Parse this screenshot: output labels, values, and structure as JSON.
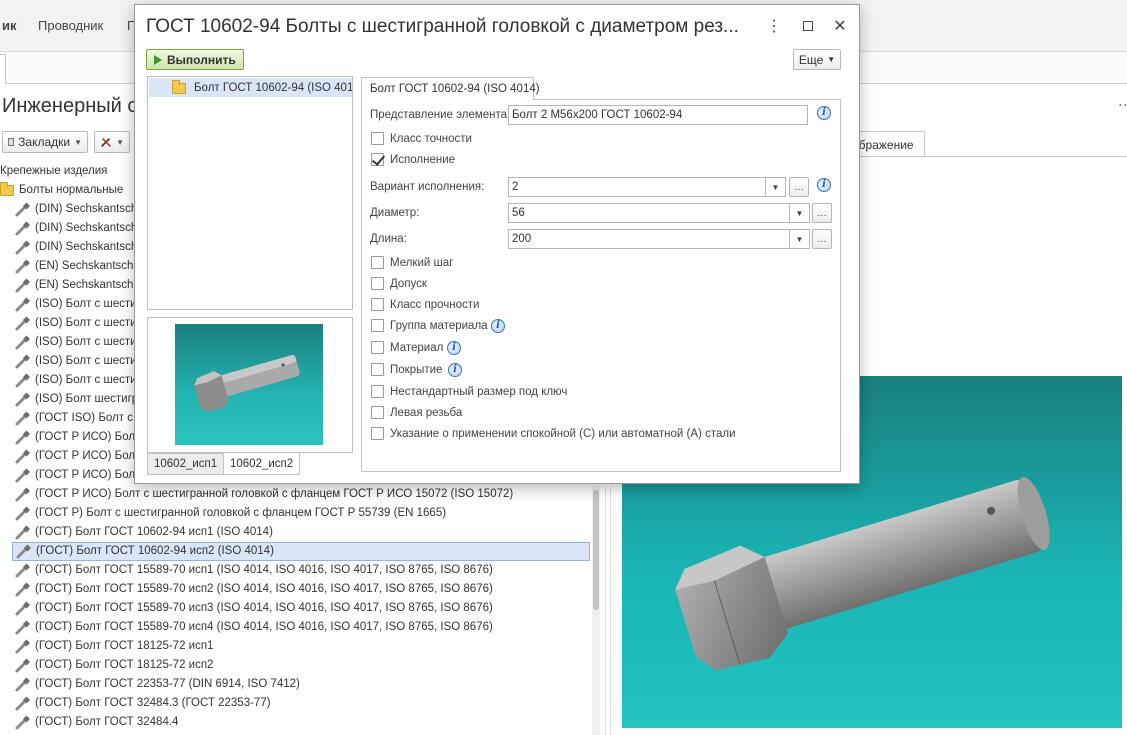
{
  "app": {
    "menu": [
      {
        "label": "ик",
        "bold": true
      },
      {
        "label": "Проводник"
      },
      {
        "label": "П"
      }
    ],
    "page_title": "Инженерный с",
    "toolbar": {
      "bookmarks_label": "Закладки"
    },
    "tree": {
      "root_label": "Крепежные изделия",
      "folder_label": "Болты нормальные",
      "items": [
        "(DIN) Sechskantsch",
        "(DIN) Sechskantsch",
        "(DIN) Sechskantsch",
        "(EN) Sechskantschra",
        "(EN) Sechskantschra",
        "(ISO) Болт с шестиг",
        "(ISO) Болт с шестиг",
        "(ISO) Болт с шести",
        "(ISO) Болт с шести",
        "(ISO) Болт с шести",
        "(ISO) Болт шестигр",
        "(ГОСТ ISO) Болт с ш",
        "(ГОСТ Р ИСО) Болт",
        "(ГОСТ Р ИСО) Болт",
        "(ГОСТ Р ИСО) Болт",
        "(ГОСТ Р ИСО) Болт с шестигранной головкой с фланцем ГОСТ Р ИСО 15072 (ISO 15072)",
        "(ГОСТ Р) Болт с шестигранной головкой с фланцем ГОСТ Р 55739 (EN 1665)",
        "(ГОСТ) Болт ГОСТ 10602-94 исп1 (ISO 4014)",
        "(ГОСТ) Болт ГОСТ 10602-94 исп2 (ISO 4014)",
        "(ГОСТ) Болт ГОСТ 15589-70 исп1 (ISO 4014, ISO 4016, ISO 4017, ISO 8765, ISO 8676)",
        "(ГОСТ) Болт ГОСТ 15589-70 исп2 (ISO 4014, ISO 4016, ISO 4017, ISO 8765, ISO 8676)",
        "(ГОСТ) Болт ГОСТ 15589-70 исп3 (ISO 4014, ISO 4016, ISO 4017, ISO 8765, ISO 8676)",
        "(ГОСТ) Болт ГОСТ 15589-70 исп4 (ISO 4014, ISO 4016, ISO 4017, ISO 8765, ISO 8676)",
        "(ГОСТ) Болт ГОСТ 18125-72 исп1",
        "(ГОСТ) Болт ГОСТ 18125-72 исп2",
        "(ГОСТ) Болт ГОСТ 22353-77 (DIN 6914, ISO 7412)",
        "(ГОСТ) Болт ГОСТ 32484.3 (ГОСТ 22353-77)",
        "(ГОСТ) Болт ГОСТ 32484.4"
      ],
      "selected_index": 18
    },
    "right_tab_label": "ображение"
  },
  "dialog": {
    "title": "ГОСТ 10602-94 Болты с шестигранной головкой с диаметром рез...",
    "run_label": "Выполнить",
    "more_label": "Еще",
    "list_item": "Болт ГОСТ 10602-94 (ISO 401...",
    "preview_tabs": [
      "10602_исп1",
      "10602_исп2"
    ],
    "form_tab": "Болт ГОСТ 10602-94 (ISO 4014)",
    "fields": {
      "presentation": {
        "label": "Представление элемента:",
        "value": "Болт 2  M56x200 ГОСТ 10602-94"
      },
      "variant": {
        "label": "Вариант исполнения:",
        "value": "2"
      },
      "diameter": {
        "label": "Диаметр:",
        "value": "56"
      },
      "length": {
        "label": "Длина:",
        "value": "200"
      }
    },
    "checkboxes": {
      "accuracy_class": {
        "label": "Класс точности",
        "checked": false
      },
      "execution": {
        "label": "Исполнение",
        "checked": true
      },
      "fine_pitch": {
        "label": "Мелкий шаг",
        "checked": false
      },
      "tolerance": {
        "label": "Допуск",
        "checked": false
      },
      "strength_class": {
        "label": "Класс прочности",
        "checked": false
      },
      "material_group": {
        "label": "Группа материала",
        "checked": false
      },
      "material": {
        "label": "Материал",
        "checked": false
      },
      "coating": {
        "label": "Покрытие",
        "checked": false
      },
      "nonstandard_key": {
        "label": "Нестандартный размер под ключ",
        "checked": false
      },
      "left_thread": {
        "label": "Левая резьба",
        "checked": false
      },
      "steel_note": {
        "label": "Указание о применении спокойной (С) или автоматной (А) стали",
        "checked": false
      }
    }
  }
}
